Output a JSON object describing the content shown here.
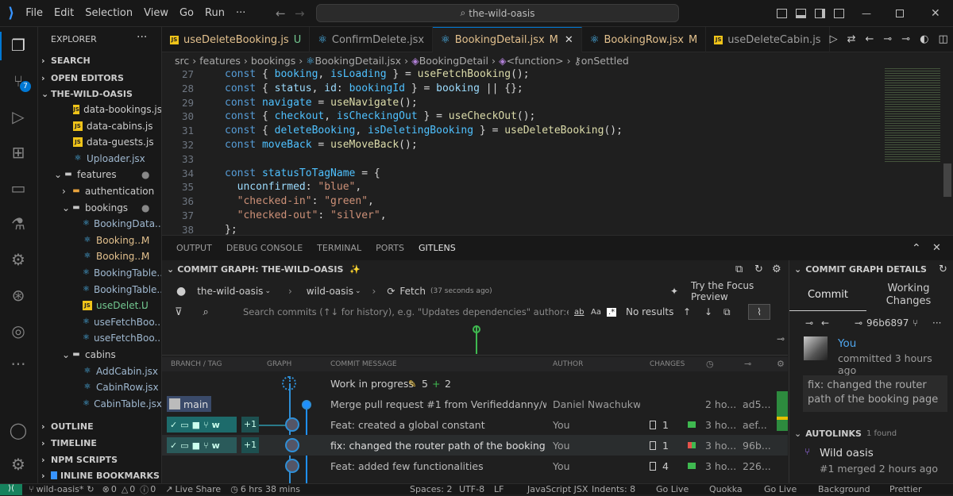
{
  "titlebar": {
    "menus": [
      "File",
      "Edit",
      "Selection",
      "View",
      "Go",
      "Run"
    ],
    "more": "···",
    "search": "the-wild-oasis"
  },
  "sidebar": {
    "title": "EXPLORER",
    "more": "···",
    "sections": {
      "search": "SEARCH",
      "open_editors": "OPEN EDITORS",
      "root": "THE-WILD-OASIS",
      "outline": "OUTLINE",
      "timeline": "TIMELINE",
      "npm": "NPM SCRIPTS",
      "bookmarks": "INLINE BOOKMARKS"
    },
    "files": [
      {
        "name": "data-bookings.js",
        "type": "js",
        "indent": 1,
        "badge": ""
      },
      {
        "name": "data-cabins.js",
        "type": "js",
        "indent": 1,
        "badge": ""
      },
      {
        "name": "data-guests.js",
        "type": "js",
        "indent": 1,
        "badge": ""
      },
      {
        "name": "Uploader.jsx",
        "type": "react",
        "indent": 1,
        "badge": ""
      },
      {
        "name": "features",
        "type": "folder",
        "indent": 0,
        "badge": "●"
      },
      {
        "name": "authentication",
        "type": "folder-closed",
        "indent": 1,
        "badge": ""
      },
      {
        "name": "bookings",
        "type": "folder",
        "indent": 1,
        "badge": "●"
      },
      {
        "name": "BookingData...",
        "type": "react",
        "indent": 2,
        "badge": ""
      },
      {
        "name": "Booking...",
        "type": "react",
        "indent": 2,
        "badge": "M"
      },
      {
        "name": "Booking...",
        "type": "react",
        "indent": 2,
        "badge": "M"
      },
      {
        "name": "BookingTable...",
        "type": "react",
        "indent": 2,
        "badge": ""
      },
      {
        "name": "BookingTable...",
        "type": "react",
        "indent": 2,
        "badge": ""
      },
      {
        "name": "useDelet...",
        "type": "js",
        "indent": 2,
        "badge": "U"
      },
      {
        "name": "useFetchBoo...",
        "type": "react",
        "indent": 2,
        "badge": ""
      },
      {
        "name": "useFetchBoo...",
        "type": "react",
        "indent": 2,
        "badge": ""
      },
      {
        "name": "cabins",
        "type": "folder",
        "indent": 1,
        "badge": ""
      },
      {
        "name": "AddCabin.jsx",
        "type": "react",
        "indent": 2,
        "badge": ""
      },
      {
        "name": "CabinRow.jsx",
        "type": "react",
        "indent": 2,
        "badge": ""
      },
      {
        "name": "CabinTable.jsx",
        "type": "react",
        "indent": 2,
        "badge": ""
      }
    ]
  },
  "activity": {
    "scm_badge": "7"
  },
  "tabs": [
    {
      "label": "useDeleteBooking.js",
      "badge": "U",
      "icon": "js",
      "active": false
    },
    {
      "label": "ConfirmDelete.jsx",
      "badge": "",
      "icon": "react",
      "active": false
    },
    {
      "label": "BookingDetail.jsx",
      "badge": "M",
      "icon": "react",
      "active": true
    },
    {
      "label": "BookingRow.jsx",
      "badge": "M",
      "icon": "react",
      "active": false
    },
    {
      "label": "useDeleteCabin.js",
      "badge": "",
      "icon": "js",
      "active": false
    }
  ],
  "breadcrumb": {
    "items": [
      "src",
      "features",
      "bookings",
      "BookingDetail.jsx",
      "BookingDetail",
      "<function>",
      "onSettled"
    ]
  },
  "editor": {
    "lines": [
      {
        "n": "27",
        "tokens": [
          [
            "kw",
            "const "
          ],
          [
            "pn",
            "{ "
          ],
          [
            "cn",
            "booking"
          ],
          [
            "pn",
            ", "
          ],
          [
            "cn",
            "isLoading"
          ],
          [
            "pn",
            " } = "
          ],
          [
            "fn",
            "useFetchBooking"
          ],
          [
            "pn",
            "();"
          ]
        ]
      },
      {
        "n": "28",
        "tokens": [
          [
            "kw",
            "const "
          ],
          [
            "pn",
            "{ "
          ],
          [
            "vr",
            "status"
          ],
          [
            "pn",
            ", "
          ],
          [
            "vr",
            "id"
          ],
          [
            "pn",
            ": "
          ],
          [
            "cn",
            "bookingId"
          ],
          [
            "pn",
            " } = "
          ],
          [
            "vr",
            "booking"
          ],
          [
            "pn",
            " || {};"
          ]
        ]
      },
      {
        "n": "29",
        "tokens": [
          [
            "kw",
            "const "
          ],
          [
            "cn",
            "navigate"
          ],
          [
            "pn",
            " = "
          ],
          [
            "fn",
            "useNavigate"
          ],
          [
            "pn",
            "();"
          ]
        ]
      },
      {
        "n": "30",
        "tokens": [
          [
            "kw",
            "const "
          ],
          [
            "pn",
            "{ "
          ],
          [
            "cn",
            "checkout"
          ],
          [
            "pn",
            ", "
          ],
          [
            "cn",
            "isCheckingOut"
          ],
          [
            "pn",
            " } = "
          ],
          [
            "fn",
            "useCheckOut"
          ],
          [
            "pn",
            "();"
          ]
        ]
      },
      {
        "n": "31",
        "tokens": [
          [
            "kw",
            "const "
          ],
          [
            "pn",
            "{ "
          ],
          [
            "cn",
            "deleteBooking"
          ],
          [
            "pn",
            ", "
          ],
          [
            "cn",
            "isDeletingBooking"
          ],
          [
            "pn",
            " } = "
          ],
          [
            "fn",
            "useDeleteBooking"
          ],
          [
            "pn",
            "();"
          ]
        ]
      },
      {
        "n": "32",
        "tokens": [
          [
            "kw",
            "const "
          ],
          [
            "cn",
            "moveBack"
          ],
          [
            "pn",
            " = "
          ],
          [
            "fn",
            "useMoveBack"
          ],
          [
            "pn",
            "();"
          ]
        ]
      },
      {
        "n": "33",
        "tokens": []
      },
      {
        "n": "34",
        "tokens": [
          [
            "kw",
            "const "
          ],
          [
            "cn",
            "statusToTagName"
          ],
          [
            "pn",
            " = {"
          ]
        ]
      },
      {
        "n": "35",
        "tokens": [
          [
            "pn",
            "  "
          ],
          [
            "vr",
            "unconfirmed"
          ],
          [
            "pn",
            ": "
          ],
          [
            "st",
            "\"blue\""
          ],
          [
            "pn",
            ","
          ]
        ]
      },
      {
        "n": "36",
        "tokens": [
          [
            "pn",
            "  "
          ],
          [
            "st",
            "\"checked-in\""
          ],
          [
            "pn",
            ": "
          ],
          [
            "st",
            "\"green\""
          ],
          [
            "pn",
            ","
          ]
        ]
      },
      {
        "n": "37",
        "tokens": [
          [
            "pn",
            "  "
          ],
          [
            "st",
            "\"checked-out\""
          ],
          [
            "pn",
            ": "
          ],
          [
            "st",
            "\"silver\""
          ],
          [
            "pn",
            ","
          ]
        ]
      },
      {
        "n": "38",
        "tokens": [
          [
            "pn",
            "};"
          ]
        ]
      }
    ]
  },
  "panel": {
    "tabs": [
      "OUTPUT",
      "DEBUG CONSOLE",
      "TERMINAL",
      "PORTS",
      "GITLENS"
    ],
    "graph_title": "COMMIT GRAPH: THE-WILD-OASIS",
    "repo": "the-wild-oasis",
    "branch": "wild-oasis",
    "fetch": "Fetch",
    "fetch_time": "(37 seconds ago)",
    "focus": "Try the Focus Preview",
    "search_placeholder": "Search commits (↑↓ for history), e.g. \"Updates dependencies\" author:eamodio",
    "search_results": "No results",
    "headers": {
      "branch": "BRANCH / TAG",
      "graph": "GRAPH",
      "message": "COMMIT MESSAGE",
      "author": "AUTHOR",
      "changes": "CHANGES"
    },
    "wip": {
      "message": "Work in progress",
      "edits": "5",
      "adds": "2"
    },
    "commits": [
      {
        "branch": "main",
        "message": "Merge pull request #1 from Verifieddanny/wild-oasi...",
        "author": "Daniel Nwachukwu",
        "changes": "",
        "time": "2 ho...",
        "sha": "ad5...",
        "selected": false
      },
      {
        "branch": "w",
        "plus": "+1",
        "message": "Feat: created a global constant",
        "author": "You",
        "changes": "1",
        "time": "3 ho...",
        "sha": "aef...",
        "selected": false
      },
      {
        "branch": "w",
        "plus": "+1",
        "message": "fix: changed the router path of the booking page",
        "author": "You",
        "changes": "1",
        "time": "3 ho...",
        "sha": "96b...",
        "selected": true
      },
      {
        "branch": "",
        "plus": "",
        "message": "Feat: added few functionalities",
        "author": "You",
        "changes": "4",
        "time": "3 ho...",
        "sha": "226...",
        "selected": false
      }
    ]
  },
  "details": {
    "title": "COMMIT GRAPH DETAILS",
    "tab_commit": "Commit",
    "tab_changes": "Working Changes",
    "sha": "96b6897",
    "author": "You",
    "committed": "committed 3 hours ago",
    "message": "fix: changed the router path of the booking page",
    "autolinks": "AUTOLINKS",
    "found": "1 found",
    "link_title": "Wild oasis",
    "link_sub": "#1 merged 2 hours ago"
  },
  "status": {
    "branch": "wild-oasis*",
    "errors": "0",
    "warnings": "0",
    "infos": "0",
    "liveshare": "Live Share",
    "time": "6 hrs 38 mins",
    "spaces": "Spaces: 2",
    "encoding": "UTF-8",
    "eol": "LF",
    "lang": "JavaScript JSX",
    "indents": "Indents: 8",
    "golive": "Go Live",
    "quokka": "Quokka",
    "golive2": "Go Live",
    "background": "Background",
    "prettier": "Prettier"
  }
}
